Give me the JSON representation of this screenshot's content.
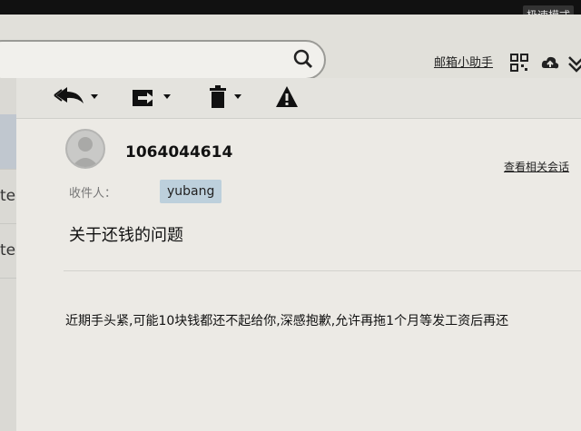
{
  "bezel": {
    "label": "极速模式"
  },
  "header": {
    "helper_link": "邮箱小助手",
    "icons": [
      "search-icon",
      "qrcode-icon",
      "cloud-icon",
      "more-icon"
    ]
  },
  "sidebar": {
    "items": [
      {
        "label": "te"
      },
      {
        "label": "te"
      }
    ]
  },
  "toolbar": {
    "tools": [
      "reply-icon",
      "forward-icon",
      "delete-icon",
      "report-icon"
    ]
  },
  "mail": {
    "sender": "1064044614",
    "related_link": "查看相关会话",
    "recipient_label": "收件人：",
    "recipient": "yubang",
    "subject": "关于还钱的问题",
    "body": "近期手头紧,可能10块钱都还不起给你,深感抱歉,允许再拖1个月等发工资后再还"
  },
  "colors": {
    "background": "#e9e7e1",
    "chip": "#bdd0dc",
    "bezel": "#111111"
  }
}
